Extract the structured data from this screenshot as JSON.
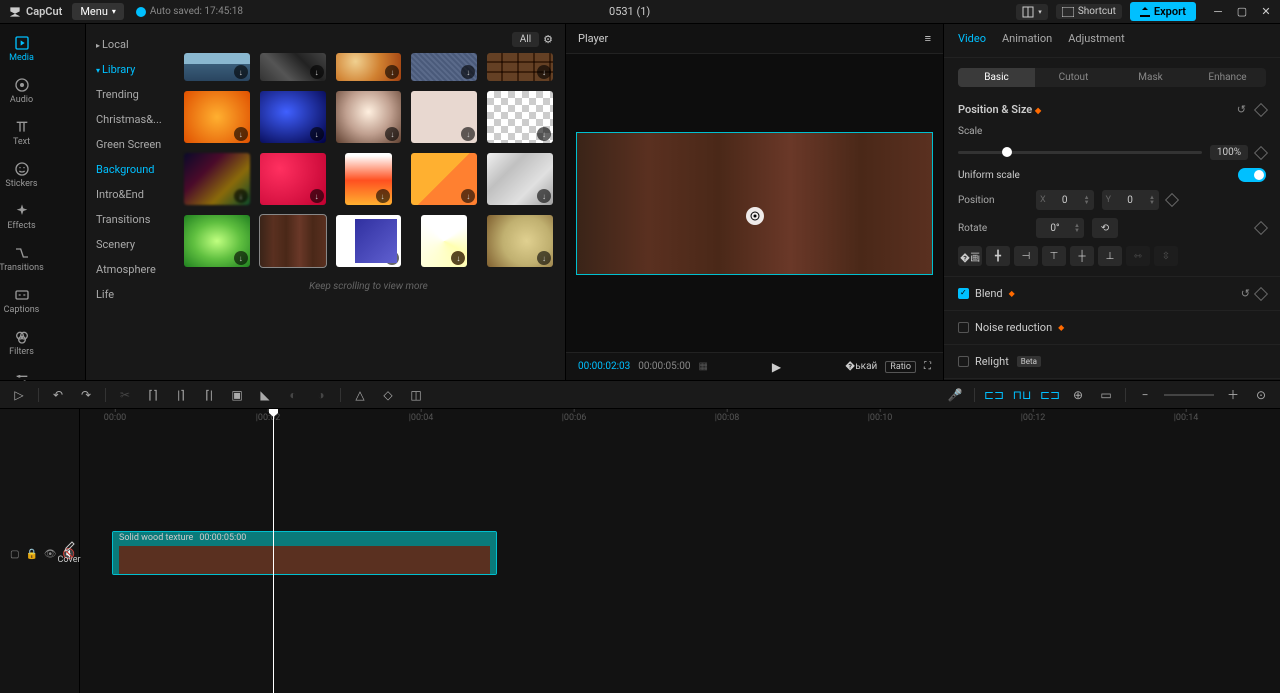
{
  "titlebar": {
    "logo": "CapCut",
    "menu": "Menu",
    "autosave": "Auto saved: 17:45:18",
    "project": "0531 (1)",
    "shortcut": "Shortcut",
    "export": "Export"
  },
  "nav": {
    "tabs": [
      "Media",
      "Audio",
      "Text",
      "Stickers",
      "Effects",
      "Transitions",
      "Captions",
      "Filters",
      "Adjustment"
    ],
    "active": "Media"
  },
  "sidebar": {
    "items": [
      {
        "label": "Local",
        "type": "expandable"
      },
      {
        "label": "Library",
        "type": "expanded",
        "active": true
      },
      {
        "label": "Trending"
      },
      {
        "label": "Christmas&..."
      },
      {
        "label": "Green Screen"
      },
      {
        "label": "Background",
        "active": true
      },
      {
        "label": "Intro&End"
      },
      {
        "label": "Transitions"
      },
      {
        "label": "Scenery"
      },
      {
        "label": "Atmosphere"
      },
      {
        "label": "Life"
      }
    ]
  },
  "browser": {
    "all": "All",
    "scroll_hint": "Keep scrolling to view more"
  },
  "player": {
    "title": "Player",
    "current": "00:00:02:03",
    "duration": "00:00:05:00",
    "ratio": "Ratio"
  },
  "right": {
    "tabs": [
      "Video",
      "Animation",
      "Adjustment"
    ],
    "active": "Video",
    "subtabs": [
      "Basic",
      "Cutout",
      "Mask",
      "Enhance"
    ],
    "sub_active": "Basic",
    "position_size": "Position & Size",
    "scale": "Scale",
    "scale_value": "100%",
    "uniform": "Uniform scale",
    "position": "Position",
    "pos_x": "0",
    "pos_y": "0",
    "rotate": "Rotate",
    "rotate_value": "0°",
    "blend": "Blend",
    "noise": "Noise reduction",
    "relight": "Relight",
    "relight_badge": "Beta"
  },
  "timeline": {
    "marks": [
      "00:00",
      "|00:02",
      "|00:04",
      "|00:06",
      "|00:08",
      "|00:10",
      "|00:12",
      "|00:14"
    ],
    "cover": "Cover",
    "clip_name": "Solid wood texture",
    "clip_dur": "00:00:05:00"
  }
}
